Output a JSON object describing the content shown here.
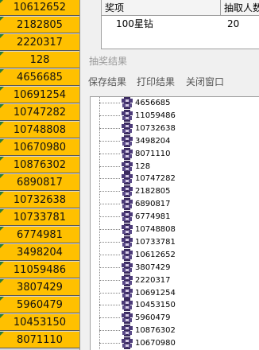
{
  "sheet": {
    "cells": [
      "10612652",
      "2182805",
      "2220317",
      "128",
      "4656685",
      "10691254",
      "10747282",
      "10748808",
      "10670980",
      "10876302",
      "6890817",
      "10732638",
      "10733781",
      "6774981",
      "3498204",
      "11059486",
      "3807429",
      "5960479",
      "10453150",
      "8071110"
    ],
    "cell_color": "#ffc000",
    "marker_color": "#2e7d32"
  },
  "prize_table": {
    "headers": [
      "奖项",
      "抽取人数"
    ],
    "rows": [
      {
        "prize": "100星钻",
        "count": "20"
      }
    ]
  },
  "dialog": {
    "title": "抽奖结果",
    "menu": [
      "保存结果",
      "打印结果",
      "关闭窗口"
    ],
    "results": [
      "4656685",
      "11059486",
      "10732638",
      "3498204",
      "8071110",
      "128",
      "10747282",
      "2182805",
      "6890817",
      "6774981",
      "10748808",
      "10733781",
      "10612652",
      "3807429",
      "2220317",
      "10691254",
      "10453150",
      "5960479",
      "10876302",
      "10670980"
    ]
  }
}
